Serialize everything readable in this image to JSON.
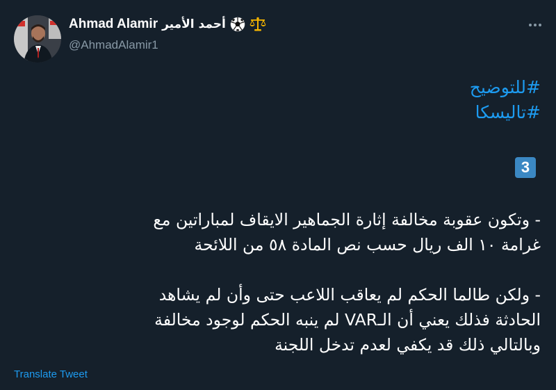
{
  "author": {
    "display_name": "Ahmad Alamir",
    "arabic_name": "أحمد الأمير",
    "handle": "@AhmadAlamir1",
    "badges": [
      "soccer-ball-icon",
      "scales-icon"
    ]
  },
  "tweet": {
    "hashtags": [
      "#للتوضيح",
      "#تاليسكا"
    ],
    "number_badge": "3",
    "paragraphs": [
      {
        "lines": [
          "- وتكون عقوبة مخالفة إثارة الجماهير الايقاف لمباراتين مع",
          "غرامة ١٠ الف ريال حسب نص المادة ٥٨ من اللائحة"
        ]
      },
      {
        "lines": [
          "- ولكن طالما الحكم لم يعاقب اللاعب حتى وأن لم يشاهد",
          "الحادثة فذلك يعني أن الـVAR لم ينبه الحكم لوجود مخالفة",
          "وبالتالي ذلك قد يكفي لعدم تدخل اللجنة"
        ]
      }
    ],
    "translate_label": "Translate Tweet"
  },
  "colors": {
    "background": "#15202b",
    "link": "#1d9bf0",
    "secondary_text": "#8899a6",
    "keycap": "#3b88c3"
  }
}
